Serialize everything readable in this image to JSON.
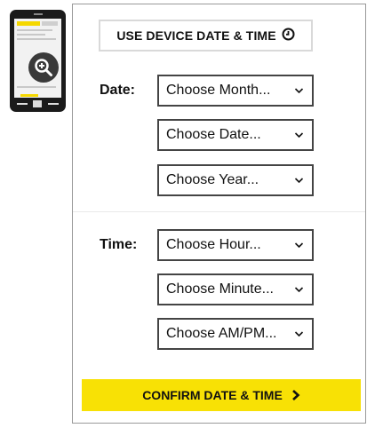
{
  "use_device_button": {
    "label": "USE DEVICE DATE & TIME",
    "icon": "clock-icon"
  },
  "date": {
    "label": "Date:",
    "month_select": "Choose Month...",
    "day_select": "Choose Date...",
    "year_select": "Choose Year..."
  },
  "time": {
    "label": "Time:",
    "hour_select": "Choose Hour...",
    "minute_select": "Choose Minute...",
    "ampm_select": "Choose AM/PM..."
  },
  "confirm_button": {
    "label": "CONFIRM DATE & TIME",
    "icon": "chevron-right-icon"
  },
  "thumbnail": {
    "icon": "zoom-in-icon"
  },
  "colors": {
    "accent": "#f8e105",
    "border": "#444444"
  }
}
